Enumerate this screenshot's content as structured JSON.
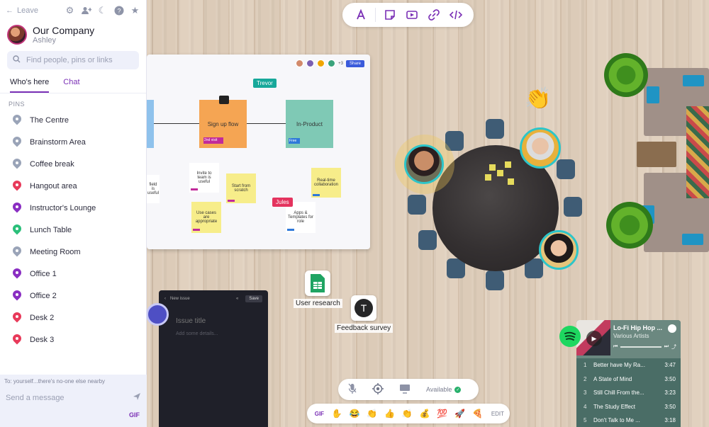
{
  "sidebar": {
    "leave_label": "Leave",
    "org_name": "Our Company",
    "user_name": "Ashley",
    "search_placeholder": "Find people, pins or links",
    "tabs": [
      {
        "label": "Who's here"
      },
      {
        "label": "Chat"
      }
    ],
    "pins_heading": "PINS",
    "pins": [
      {
        "label": "The Centre",
        "color": "#9aa4b8"
      },
      {
        "label": "Brainstorm Area",
        "color": "#9aa4b8"
      },
      {
        "label": "Coffee break",
        "color": "#9aa4b8"
      },
      {
        "label": "Hangout area",
        "color": "#e83a5a"
      },
      {
        "label": "Instructor's Lounge",
        "color": "#8a2ec2"
      },
      {
        "label": "Lunch Table",
        "color": "#2bbf7a"
      },
      {
        "label": "Meeting Room",
        "color": "#9aa4b8"
      },
      {
        "label": "Office 1",
        "color": "#8a2ec2"
      },
      {
        "label": "Office 2",
        "color": "#8a2ec2"
      },
      {
        "label": "Desk 2",
        "color": "#e83a5a"
      },
      {
        "label": "Desk 3",
        "color": "#e83a5a"
      }
    ],
    "message_to": "To: yourself...there's no-one else nearby",
    "message_placeholder": "Send a message",
    "gif_label": "GIF"
  },
  "whiteboard": {
    "share_label": "Share",
    "avatar_count": "+3",
    "notes": {
      "signup": "Sign up flow",
      "signup_tag": "2nd visit",
      "inproduct": "In-Product",
      "inproduct_tag": "Free",
      "invite": "Invite to team is useful",
      "start": "Start from scratch",
      "realtime": "Real-time collaboration",
      "usecases": "Use cases are appropriate",
      "apps": "Apps & Templates for role",
      "field": "field is useful"
    },
    "cursors": {
      "trevor": "Trevor",
      "jules": "Jules"
    }
  },
  "apps": {
    "sheets_label": "User research",
    "typeform_label": "Feedback survey"
  },
  "issue": {
    "header": "New issue",
    "save_label": "Save",
    "title_placeholder": "Issue title",
    "details_placeholder": "Add some details..."
  },
  "status": {
    "available_label": "Available"
  },
  "reactions": {
    "gif_label": "GIF",
    "emojis": [
      "✋",
      "😂",
      "👏",
      "👍",
      "👏",
      "💰",
      "💯",
      "🚀",
      "🍕"
    ],
    "edit_label": "EDIT"
  },
  "spotify": {
    "playlist_title": "Lo-Fi Hip Hop ...",
    "artist": "Various Artists",
    "tracks": [
      {
        "n": "1",
        "title": "Better have My Ra...",
        "duration": "3:47"
      },
      {
        "n": "2",
        "title": "A State of Mind",
        "duration": "3:50"
      },
      {
        "n": "3",
        "title": "Still Chill From the...",
        "duration": "3:23"
      },
      {
        "n": "4",
        "title": "The Study Effect",
        "duration": "3:50"
      },
      {
        "n": "5",
        "title": "Don't Talk to Me ...",
        "duration": "3:18"
      }
    ]
  },
  "colors": {
    "accent": "#7a2fb5",
    "spotify": "#1ed760"
  }
}
